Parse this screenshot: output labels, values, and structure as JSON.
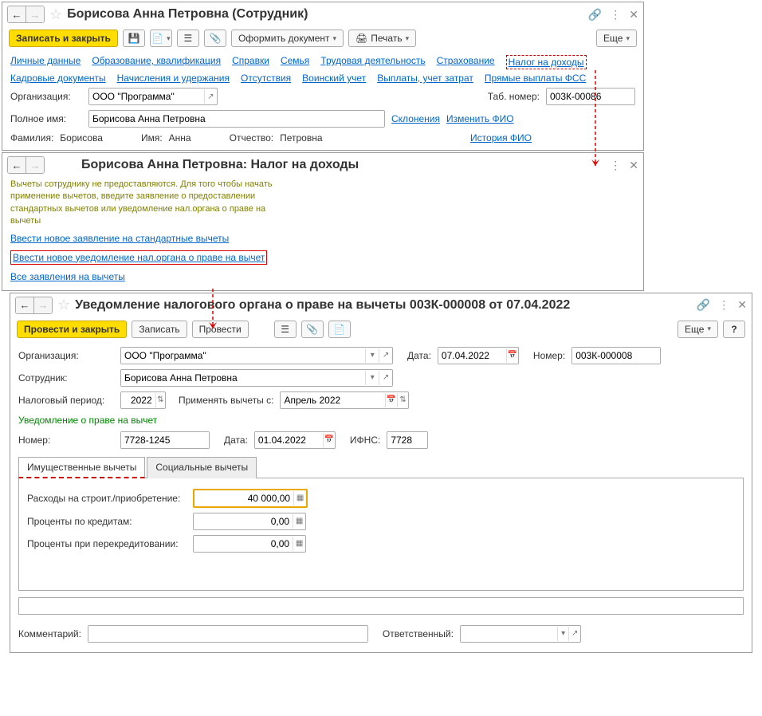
{
  "win1": {
    "title": "Борисова Анна Петровна (Сотрудник)",
    "btn_save_close": "Записать и закрыть",
    "btn_doc": "Оформить документ",
    "btn_print": "Печать",
    "btn_more": "Еще",
    "links1": [
      "Личные данные",
      "Образование, квалификация",
      "Справки",
      "Семья",
      "Трудовая деятельность",
      "Страхование",
      "Налог на доходы"
    ],
    "links2": [
      "Кадровые документы",
      "Начисления и удержания",
      "Отсутствия",
      "Воинский учет",
      "Выплаты, учет затрат",
      "Прямые выплаты ФСС"
    ],
    "org_label": "Организация:",
    "org_value": "ООО \"Программа\"",
    "tab_label": "Таб. номер:",
    "tab_value": "003К-00086",
    "fullname_label": "Полное имя:",
    "fullname_value": "Борисова Анна Петровна",
    "link_decl": "Склонения",
    "link_change": "Изменить ФИО",
    "fam_label": "Фамилия:",
    "fam_value": "Борисова",
    "name_label": "Имя:",
    "name_value": "Анна",
    "patr_label": "Отчество:",
    "patr_value": "Петровна",
    "link_history": "История ФИО"
  },
  "win2": {
    "title": "Борисова Анна Петровна: Налог на доходы",
    "olive_text": "Вычеты сотруднику не предоставляются. Для того чтобы начать применение вычетов, введите заявление о предоставлении стандартных вычетов или уведомление нал.органа о праве на вычеты",
    "link1": "Ввести новое заявление на стандартные вычеты",
    "link2": "Ввести новое уведомление нал.органа о праве на вычет",
    "link3": "Все заявления на вычеты"
  },
  "win3": {
    "title": "Уведомление налогового органа о праве на вычеты 003К-000008 от 07.04.2022",
    "btn_post_close": "Провести и закрыть",
    "btn_save": "Записать",
    "btn_post": "Провести",
    "btn_more": "Еще",
    "org_label": "Организация:",
    "org_value": "ООО \"Программа\"",
    "date_label": "Дата:",
    "date_value": "07.04.2022",
    "num_label": "Номер:",
    "num_value": "003К-000008",
    "emp_label": "Сотрудник:",
    "emp_value": "Борисова Анна Петровна",
    "period_label": "Налоговый период:",
    "period_value": "2022",
    "apply_label": "Применять вычеты с:",
    "apply_value": "Апрель 2022",
    "green_heading": "Уведомление о праве на вычет",
    "notif_num_label": "Номер:",
    "notif_num_value": "7728-1245",
    "notif_date_label": "Дата:",
    "notif_date_value": "01.04.2022",
    "ifns_label": "ИФНС:",
    "ifns_value": "7728",
    "tab1": "Имущественные вычеты",
    "tab2": "Социальные вычеты",
    "row1_label": "Расходы на строит./приобретение:",
    "row1_value": "40 000,00",
    "row2_label": "Проценты по кредитам:",
    "row2_value": "0,00",
    "row3_label": "Проценты при перекредитовании:",
    "row3_value": "0,00",
    "comment_label": "Комментарий:",
    "resp_label": "Ответственный:"
  }
}
